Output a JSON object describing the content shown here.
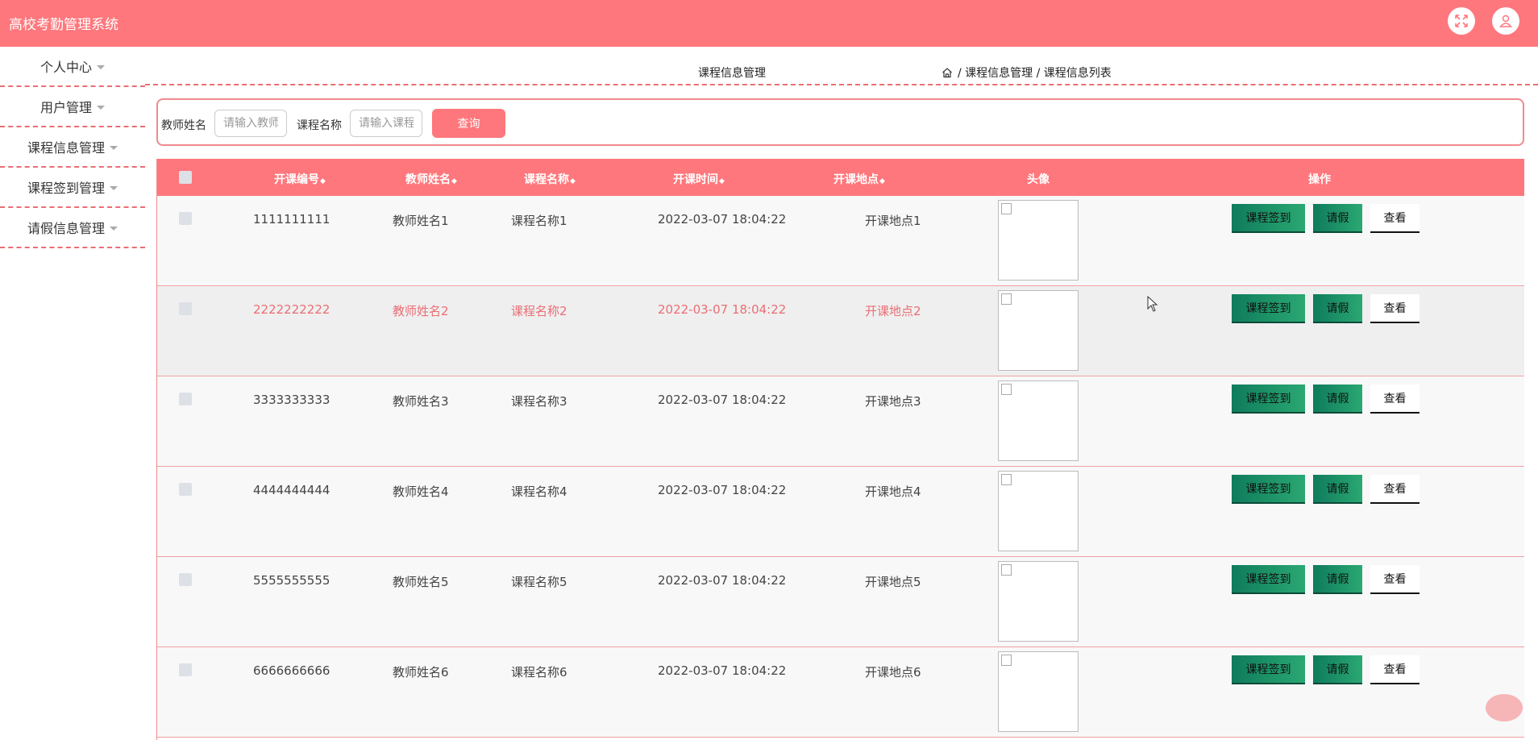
{
  "app": {
    "title": "高校考勤管理系统"
  },
  "sidebar": {
    "items": [
      {
        "label": "个人中心"
      },
      {
        "label": "用户管理"
      },
      {
        "label": "课程信息管理"
      },
      {
        "label": "课程签到管理"
      },
      {
        "label": "请假信息管理"
      }
    ]
  },
  "breadcrumb": {
    "title": "课程信息管理",
    "path": "/ 课程信息管理 / 课程信息列表"
  },
  "search": {
    "teacher_label": "教师姓名",
    "teacher_placeholder": "请输入教师",
    "course_label": "课程名称",
    "course_placeholder": "请输入课程",
    "query_button": "查询"
  },
  "table": {
    "columns": {
      "code": "开课编号",
      "teacher": "教师姓名",
      "course": "课程名称",
      "time": "开课时间",
      "place": "开课地点",
      "avatar": "头像",
      "actions": "操作"
    },
    "sort_glyph": "◆",
    "actions": {
      "signin": "课程签到",
      "leave": "请假",
      "view": "查看"
    },
    "rows": [
      {
        "code": "1111111111",
        "teacher": "教师姓名1",
        "course": "课程名称1",
        "time": "2022-03-07 18:04:22",
        "place": "开课地点1"
      },
      {
        "code": "2222222222",
        "teacher": "教师姓名2",
        "course": "课程名称2",
        "time": "2022-03-07 18:04:22",
        "place": "开课地点2"
      },
      {
        "code": "3333333333",
        "teacher": "教师姓名3",
        "course": "课程名称3",
        "time": "2022-03-07 18:04:22",
        "place": "开课地点3"
      },
      {
        "code": "4444444444",
        "teacher": "教师姓名4",
        "course": "课程名称4",
        "time": "2022-03-07 18:04:22",
        "place": "开课地点4"
      },
      {
        "code": "5555555555",
        "teacher": "教师姓名5",
        "course": "课程名称5",
        "time": "2022-03-07 18:04:22",
        "place": "开课地点5"
      },
      {
        "code": "6666666666",
        "teacher": "教师姓名6",
        "course": "课程名称6",
        "time": "2022-03-07 18:04:22",
        "place": "开课地点6"
      }
    ]
  },
  "icons": {
    "fullscreen": "fullscreen-icon",
    "user": "user-icon",
    "home": "home-icon",
    "cursor": "mouse-cursor-icon"
  },
  "colors": {
    "primary": "#fe777c",
    "accent_green": "#1a9466"
  }
}
